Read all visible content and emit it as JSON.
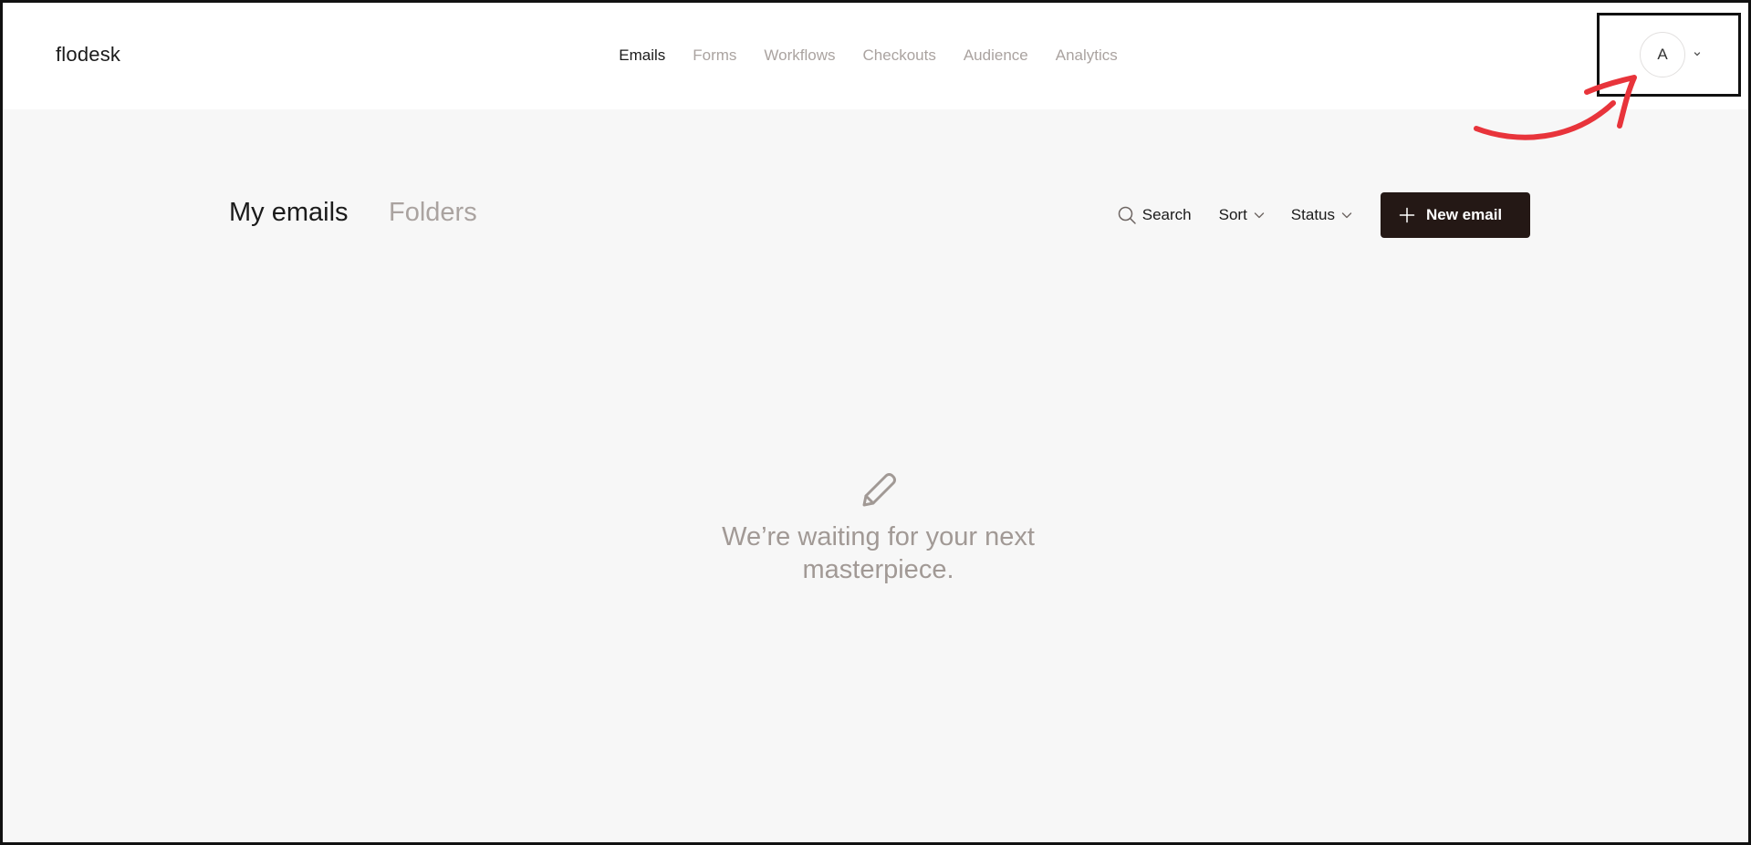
{
  "app": {
    "logo": "flodesk"
  },
  "nav": {
    "items": [
      {
        "label": "Emails",
        "active": true
      },
      {
        "label": "Forms",
        "active": false
      },
      {
        "label": "Workflows",
        "active": false
      },
      {
        "label": "Checkouts",
        "active": false
      },
      {
        "label": "Audience",
        "active": false
      },
      {
        "label": "Analytics",
        "active": false
      }
    ]
  },
  "user": {
    "avatar_initial": "A"
  },
  "page": {
    "tabs": {
      "my_emails": "My emails",
      "folders": "Folders"
    },
    "toolbar": {
      "search_label": "Search",
      "sort_label": "Sort",
      "status_label": "Status",
      "new_email_label": "New email"
    }
  },
  "empty_state": {
    "message": "We’re waiting for your next masterpiece."
  },
  "icons": {
    "search": "search-icon",
    "chevron": "chevron-down-icon",
    "plus": "plus-icon",
    "pencil": "pencil-icon"
  },
  "colors": {
    "accent": "#241815",
    "annotation": "#e8343b",
    "muted_text": "#aaa3a0",
    "background": "#f7f7f7"
  }
}
